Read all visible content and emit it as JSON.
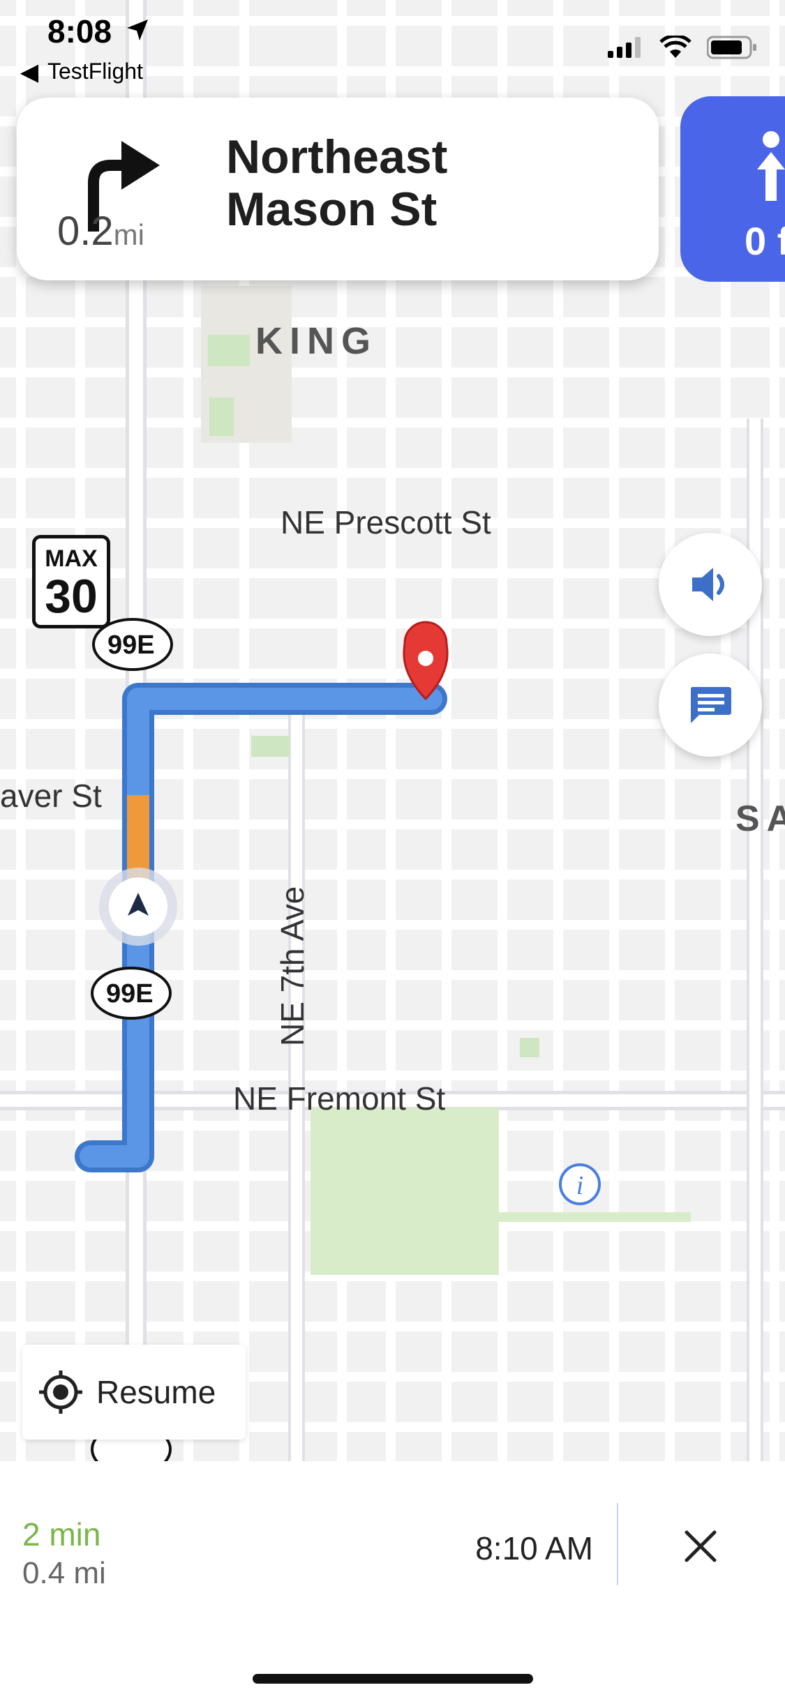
{
  "status_bar": {
    "time": "8:08",
    "back_app": "TestFlight"
  },
  "navigation": {
    "distance_value": "0.2",
    "distance_unit": "mi",
    "street": "Northeast\nMason St",
    "next_distance": "0 f",
    "maneuver_icon": "turn-right-icon",
    "next_maneuver_icon": "straight-arrow-icon",
    "accent_color": "#4a65e8"
  },
  "speed_limit": {
    "title": "MAX",
    "value": "30"
  },
  "map": {
    "labels": {
      "neighborhood": "KING",
      "prescott": "NE Prescott St",
      "beaver": "aver St",
      "seventh": "NE 7th Ave",
      "fremont": "NE Fremont St",
      "sa": "SA",
      "highway": "99E",
      "highway_partial": "99E"
    },
    "route_color": "#5b96e6",
    "traffic_color": "#ef9a3a",
    "destination_color": "#e53935"
  },
  "controls": {
    "sound_icon": "speaker-icon",
    "report_icon": "message-icon",
    "resume_label": "Resume"
  },
  "trip": {
    "duration": "2 min",
    "distance": "0.4 mi",
    "arrival_time": "8:10 AM",
    "duration_color": "#7ab648"
  }
}
